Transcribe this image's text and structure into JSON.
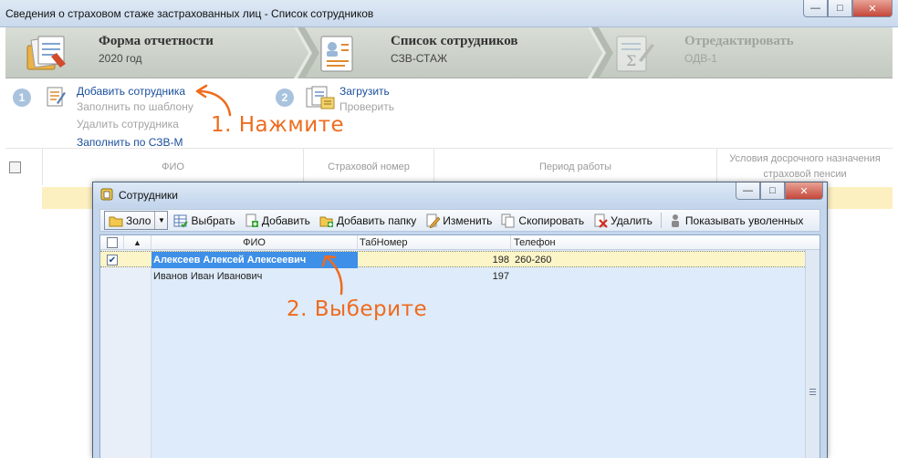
{
  "window": {
    "title": "Сведения о страховом стаже застрахованных лиц - Список сотрудников",
    "minimize": "—",
    "maximize": "□",
    "close": "✕"
  },
  "steps": [
    {
      "title": "Форма отчетности",
      "subtitle": "2020 год",
      "icon": "report-stack-icon",
      "state": "done"
    },
    {
      "title": "Список сотрудников",
      "subtitle": "СЗВ-СТАЖ",
      "icon": "employee-card-icon",
      "state": "active"
    },
    {
      "title": "Отредактировать",
      "subtitle": "ОДВ-1",
      "icon": "edit-document-icon",
      "state": "pending"
    }
  ],
  "actions": {
    "group1": {
      "number": "1",
      "links": [
        {
          "label": "Добавить сотрудника",
          "enabled": true
        },
        {
          "label": "Заполнить по шаблону",
          "enabled": false
        },
        {
          "label": "Удалить сотрудника",
          "enabled": false
        },
        {
          "label": "Заполнить по СЗВ-М",
          "enabled": true
        }
      ]
    },
    "group2": {
      "number": "2",
      "links": [
        {
          "label": "Загрузить",
          "enabled": true
        },
        {
          "label": "Проверить",
          "enabled": false
        }
      ]
    }
  },
  "annotations": {
    "step1": "1. Нажмите",
    "step2": "2. Выберите"
  },
  "background_grid": {
    "columns": [
      "ФИО",
      "Страховой номер",
      "Период работы",
      "Условия досрочного назначения страховой пенсии"
    ]
  },
  "dialog": {
    "title": "Сотрудники",
    "toolbar": {
      "combo": "Золо",
      "select": "Выбрать",
      "add": "Добавить",
      "add_folder": "Добавить папку",
      "edit": "Изменить",
      "copy": "Скопировать",
      "delete": "Удалить",
      "show_fired": "Показывать уволенных"
    },
    "grid": {
      "columns": {
        "fio": "ФИО",
        "tab": "ТабНомер",
        "phone": "Телефон"
      },
      "rows": [
        {
          "checked": true,
          "fio": "Алексеев Алексей Алексеевич",
          "tab": "198",
          "phone": "260-260",
          "selected": true
        },
        {
          "checked": false,
          "fio": "Иванов Иван Иванович",
          "tab": "197",
          "phone": "",
          "selected": false
        }
      ]
    }
  },
  "colors": {
    "link": "#1a4f9c",
    "disabled": "#a4a4a4",
    "annotation": "#ee6b1e",
    "selection": "#3e8fe8",
    "selected_row": "#fcf5c8"
  }
}
